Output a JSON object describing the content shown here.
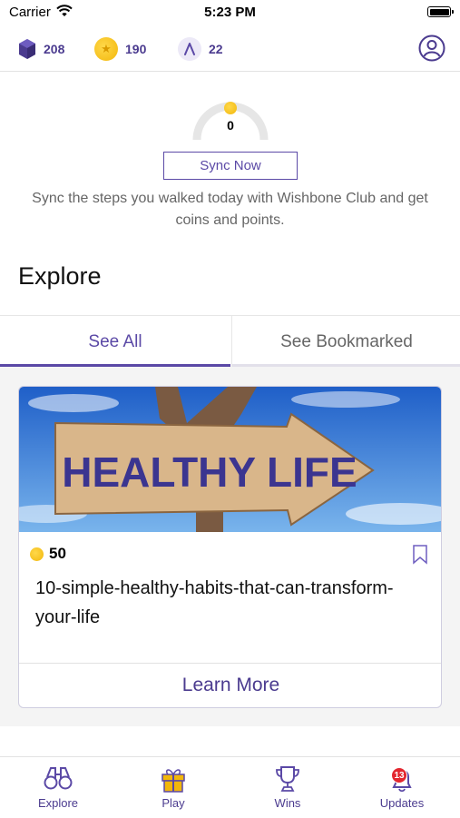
{
  "status_bar": {
    "carrier": "Carrier",
    "time": "5:23 PM"
  },
  "top_bar": {
    "gems": "208",
    "coins": "190",
    "wishbones": "22"
  },
  "step_sync": {
    "gauge_value": "0",
    "button_label": "Sync Now",
    "description": "Sync the steps you walked today with Wishbone Club and get coins and points."
  },
  "explore": {
    "title": "Explore",
    "tabs": [
      {
        "label": "See All",
        "active": true
      },
      {
        "label": "See Bookmarked",
        "active": false
      }
    ]
  },
  "card": {
    "image_text": "HEALTHY LIFE",
    "reward": "50",
    "title": "10-simple-healthy-habits-that-can-transform-your-life",
    "action_label": "Learn More"
  },
  "bottom_nav": [
    {
      "label": "Explore"
    },
    {
      "label": "Play"
    },
    {
      "label": "Wins"
    },
    {
      "label": "Updates",
      "badge": "13"
    }
  ],
  "colors": {
    "accent": "#5b49a6",
    "coin": "#f2b70b",
    "badge": "#e3262f"
  }
}
